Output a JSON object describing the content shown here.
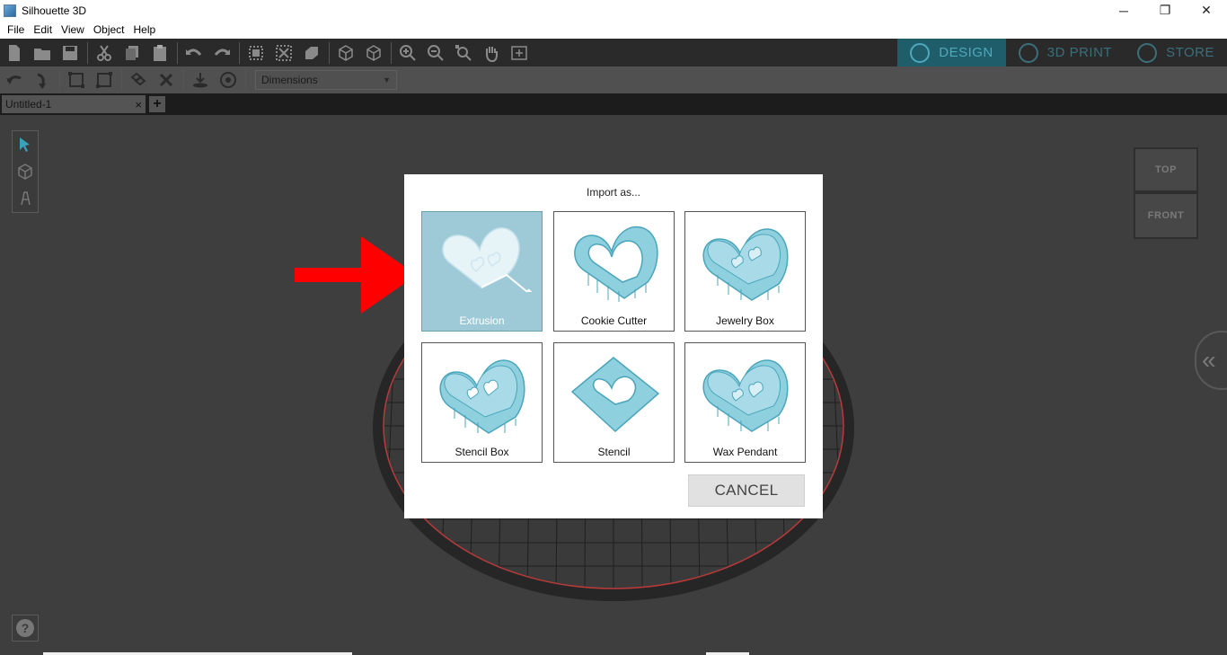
{
  "window": {
    "title": "Silhouette 3D",
    "minimize": "─",
    "restore": "❐",
    "close": "✕"
  },
  "menu": [
    "File",
    "Edit",
    "View",
    "Object",
    "Help"
  ],
  "modes": [
    {
      "label": "DESIGN",
      "icon": "design-globe-icon",
      "active": true
    },
    {
      "label": "3D PRINT",
      "icon": "print-icon",
      "active": false
    },
    {
      "label": "STORE",
      "icon": "store-icon",
      "active": false
    }
  ],
  "toolbar2": {
    "dimensions_label": "Dimensions",
    "dropdown_arrow": "▼"
  },
  "document_tab": {
    "name": "Untitled-1",
    "close": "×",
    "add": "+"
  },
  "view_cube": {
    "top": "TOP",
    "front": "FRONT"
  },
  "side_panel_toggle": "«",
  "help": "?",
  "dialog": {
    "title": "Import as...",
    "options": [
      {
        "label": "Extrusion",
        "selected": true
      },
      {
        "label": "Cookie Cutter",
        "selected": false
      },
      {
        "label": "Jewelry Box",
        "selected": false
      },
      {
        "label": "Stencil Box",
        "selected": false
      },
      {
        "label": "Stencil",
        "selected": false
      },
      {
        "label": "Wax Pendant",
        "selected": false
      }
    ],
    "cancel": "CANCEL"
  },
  "colors": {
    "accent": "#1f5d6b",
    "selected_option": "#9ecad8",
    "model_blue": "#7cc7d8",
    "annotation_arrow": "#ff0000",
    "platform_edge": "#b83a3a"
  }
}
